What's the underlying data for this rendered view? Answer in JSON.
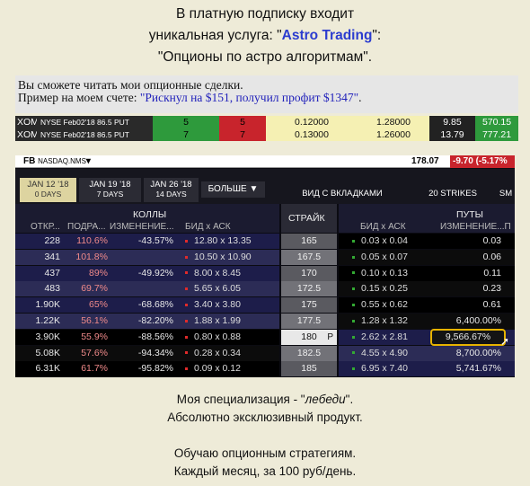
{
  "intro": {
    "line1": "В платную подписку входит",
    "line2_pre": "уникальная услуга: \"",
    "line2_brand": "Astro Trading",
    "line2_post": "\":",
    "line3": "\"Опционы по астро алгоритмам\"."
  },
  "ad": {
    "line1": "Вы сможете читать мои опционные сделки.",
    "line2_pre": "Пример на моем счете: ",
    "line2_quote": "\"Рискнул на $151, получил профит $1347\"",
    "line2_post": "."
  },
  "trades": [
    {
      "symbol": "XOM",
      "desc": "NYSE Feb02'18 86.5 PUT",
      "q1": "5",
      "q2": "5",
      "p1": "0.12000",
      "p2": "1.28000",
      "v1": "9.85",
      "v2": "570.15"
    },
    {
      "symbol": "XOM",
      "desc": "NYSE Feb02'18 86.5 PUT",
      "q1": "7",
      "q2": "7",
      "p1": "0.13000",
      "p2": "1.26000",
      "v1": "13.79",
      "v2": "777.21"
    }
  ],
  "chain": {
    "ticker": "FB",
    "exchange": "NASDAQ.NMS",
    "price": "178.07",
    "change": "-9.70 (-5.17%",
    "tabs": [
      {
        "l1": "JAN 12 '18",
        "l2": "0 DAYS"
      },
      {
        "l1": "JAN 19 '18",
        "l2": "7 DAYS"
      },
      {
        "l1": "JAN 26 '18",
        "l2": "14 DAYS"
      }
    ],
    "more": "БОЛЬШЕ",
    "view_tabs": "ВИД С ВКЛАДКАМИ",
    "strikes": "20 STRIKES",
    "sm": "SM",
    "calls_label": "КОЛЛЫ",
    "calls_cols": {
      "oi": "ОТКР...",
      "iv": "ПОДРА...",
      "chg": "ИЗМЕНЕНИЕ...",
      "bidask": "БИД x АСК"
    },
    "strike_label": "СТРАЙК",
    "puts_label": "ПУТЫ",
    "puts_cols": {
      "bidask": "БИД x АСК",
      "chg": "ИЗМЕНЕНИЕ...П"
    },
    "rows": [
      {
        "oi": "228",
        "iv": "110.6%",
        "cchg": "-43.57%",
        "cba": "12.80 x 13.35",
        "strike": "165",
        "pba": "0.03 x 0.04",
        "pchg": "0.03"
      },
      {
        "oi": "341",
        "iv": "101.8%",
        "cchg": "",
        "cba": "10.50 x 10.90",
        "strike": "167.5",
        "pba": "0.05 x 0.07",
        "pchg": "0.06"
      },
      {
        "oi": "437",
        "iv": "89%",
        "cchg": "-49.92%",
        "cba": "8.00 x 8.45",
        "strike": "170",
        "pba": "0.10 x 0.13",
        "pchg": "0.11"
      },
      {
        "oi": "483",
        "iv": "69.7%",
        "cchg": "",
        "cba": "5.65 x 6.05",
        "strike": "172.5",
        "pba": "0.15 x 0.25",
        "pchg": "0.23"
      },
      {
        "oi": "1.90K",
        "iv": "65%",
        "cchg": "-68.68%",
        "cba": "3.40 x 3.80",
        "strike": "175",
        "pba": "0.55 x 0.62",
        "pchg": "0.61"
      },
      {
        "oi": "1.22K",
        "iv": "56.1%",
        "cchg": "-82.20%",
        "cba": "1.88 x 1.99",
        "strike": "177.5",
        "pba": "1.28 x 1.32",
        "pchg": "6,400.00%"
      },
      {
        "oi": "3.90K",
        "iv": "55.9%",
        "cchg": "-88.56%",
        "cba": "0.80 x 0.88",
        "strike": "180",
        "strike_flag": "P",
        "pba": "2.62 x 2.81",
        "pchg": "9,566.67%"
      },
      {
        "oi": "5.08K",
        "iv": "57.6%",
        "cchg": "-94.34%",
        "cba": "0.28 x 0.34",
        "strike": "182.5",
        "pba": "4.55 x 4.90",
        "pchg": "8,700.00%"
      },
      {
        "oi": "6.31K",
        "iv": "61.7%",
        "cchg": "-95.82%",
        "cba": "0.09 x 0.12",
        "strike": "185",
        "pba": "6.95 x 7.40",
        "pchg": "5,741.67%"
      }
    ]
  },
  "footer": {
    "line1_pre": "Моя специализация - \"",
    "line1_em": "лебеди",
    "line1_post": "\".",
    "line2": "Абсолютно эксклюзивный продукт.",
    "line3": "Обучаю опционным стратегиям.",
    "line4": "Каждый месяц, за 100 руб/день."
  }
}
